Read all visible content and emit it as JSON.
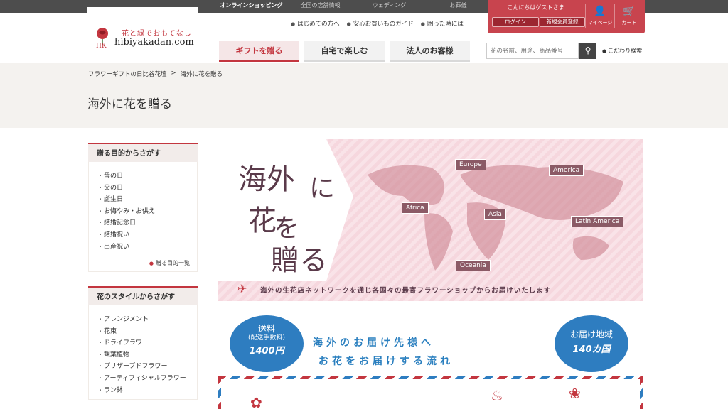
{
  "top_nav": [
    "オンラインショッピング",
    "全国の店舗情報",
    "ウェディング",
    "お葬儀"
  ],
  "logo": {
    "tagline": "花と緑でおもてなし",
    "name": "hibiyakadan.com",
    "mark": "HK"
  },
  "header_links": [
    "はじめての方へ",
    "安心お買いものガイド",
    "困った時には"
  ],
  "member": {
    "greeting": "こんにちはゲストさま",
    "login": "ログイン",
    "register": "新規会員登録",
    "mypage": "マイページ",
    "cart": "カート"
  },
  "main_tabs": [
    "ギフトを贈る",
    "自宅で楽しむ",
    "法人のお客様"
  ],
  "search": {
    "placeholder": "花の名前、用途、商品番号",
    "advanced": "こだわり検索"
  },
  "breadcrumb": {
    "home": "フラワーギフトの日比谷花壇",
    "current": "海外に花を贈る"
  },
  "page_title": "海外に花を贈る",
  "sidebar": {
    "purpose": {
      "heading": "贈る目的からさがす",
      "items": [
        "母の日",
        "父の日",
        "誕生日",
        "お悔やみ・お供え",
        "結婚記念日",
        "結婚祝い",
        "出産祝い"
      ],
      "more": "贈る目的一覧"
    },
    "style": {
      "heading": "花のスタイルからさがす",
      "items": [
        "アレンジメント",
        "花束",
        "ドライフラワー",
        "観葉植物",
        "プリザーブドフラワー",
        "アーティフィシャルフラワー",
        "ラン鉢"
      ]
    }
  },
  "hero": {
    "title_chars": [
      "海外",
      "に",
      "花",
      "を",
      "贈る"
    ],
    "subtitle": "海外の生花店ネットワークを通じ各国々の最寄フラワーショップからお届けいたします",
    "regions": [
      "Europe",
      "America",
      "Africa",
      "Asia",
      "Latin America",
      "Oceania"
    ]
  },
  "flow": {
    "title_line1": "海外のお届け先様へ",
    "title_line2": "お花をお届けする流れ",
    "shipping": {
      "label": "送料",
      "note": "(配送手数料)",
      "price": "1400円"
    },
    "coverage": {
      "label": "お届け地域",
      "count": "140カ国"
    }
  },
  "colors": {
    "accent": "#c3363f",
    "blue": "#2e7dc0",
    "topbar": "#4d4d4d"
  }
}
